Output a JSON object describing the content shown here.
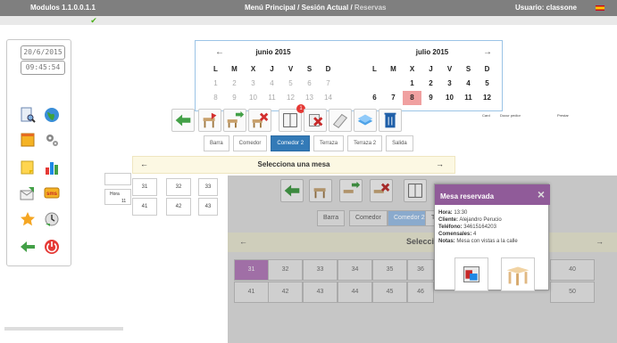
{
  "header": {
    "version": "Modulos 1.1.0.0.1.1",
    "menu": "Menú Principal",
    "separator1": "/",
    "session": "Sesión Actual",
    "separator2": "/",
    "current": "Reservas",
    "user": "Usuario: classone"
  },
  "sidebar": {
    "date": "20/6/2015",
    "time": "09:45:54"
  },
  "calendar": {
    "prev_icon": "arrow-left",
    "next_icon": "arrow-right",
    "month1": {
      "title": "junio 2015",
      "weekdays": [
        "L",
        "M",
        "X",
        "J",
        "V",
        "S",
        "D"
      ],
      "rows": [
        [
          "1",
          "2",
          "3",
          "4",
          "5",
          "6",
          "7"
        ],
        [
          "8",
          "9",
          "10",
          "11",
          "12",
          "13",
          "14"
        ]
      ]
    },
    "month2": {
      "title": "julio 2015",
      "weekdays": [
        "L",
        "M",
        "X",
        "J",
        "V",
        "S",
        "D"
      ],
      "rows": [
        [
          "",
          "",
          "1",
          "2",
          "3",
          "4",
          "5"
        ],
        [
          "6",
          "7",
          "8",
          "9",
          "10",
          "11",
          "12"
        ]
      ],
      "selected_day": "8"
    }
  },
  "toolbar": {
    "badge": "1"
  },
  "tabs": [
    "Barra",
    "Comedor",
    "Comedor 2",
    "Terraza",
    "Terraza 2",
    "Salida"
  ],
  "active_tab": 2,
  "picker": {
    "title": "Selecciona una mesa",
    "left": "←",
    "right": "→"
  },
  "tables_row1": [
    "31",
    "32",
    "33"
  ],
  "tables_row2": [
    "41",
    "42",
    "43"
  ],
  "side": {
    "hora_label": "Hora",
    "hidden_value": "11"
  },
  "minitable": {
    "col1": "Card",
    "col2": "Docur pedior",
    "col3": "Prestar"
  },
  "overlay": {
    "tabs": [
      "Barra",
      "Comedor",
      "Comedor 2",
      "T"
    ],
    "active_tab": 2,
    "bar_title": "Selecciona una mesa",
    "bar_left": "←",
    "bar_right": "→",
    "row1": [
      "31",
      "32",
      "33",
      "34",
      "35",
      "36",
      "",
      "",
      "",
      "40"
    ],
    "row2": [
      "41",
      "42",
      "43",
      "44",
      "45",
      "46",
      "",
      "",
      "",
      "50"
    ]
  },
  "modal": {
    "title": "Mesa reservada",
    "close": "×",
    "hora_label": "Hora:",
    "hora": "13:30",
    "cliente_label": "Cliente:",
    "cliente": "Alejandro Perucio",
    "telefono_label": "Teléfono:",
    "telefono": "34615164203",
    "comensales_label": "Comensales:",
    "comensales": "4",
    "notas_label": "Notas:",
    "notas": "Mesa con vistas a la calle"
  },
  "colors": {
    "topbar": "#7f7f7f",
    "accent": "#337ab7",
    "modal_header": "#905b99",
    "selected_day": "#f0a0a0",
    "reserved_table": "#a06fa6"
  }
}
